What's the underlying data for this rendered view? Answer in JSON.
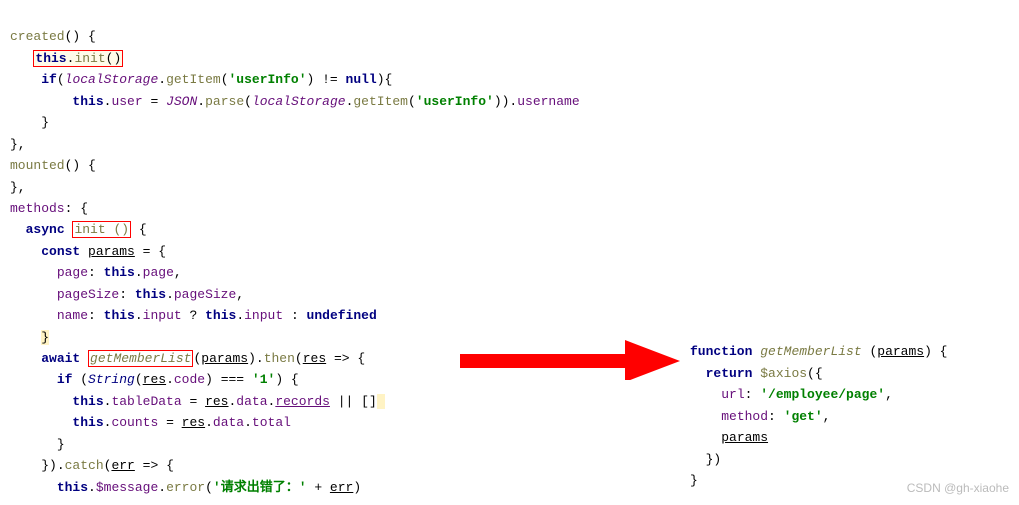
{
  "left": {
    "l1a": "created",
    "l1b": "() {",
    "l2a": "this",
    "l2b": ".",
    "l2c": "init",
    "l2d": "()",
    "l3a": "if",
    "l3b": "(",
    "l3c": "localStorage",
    "l3d": ".",
    "l3e": "getItem",
    "l3f": "(",
    "l3g": "'userInfo'",
    "l3h": ") != ",
    "l3i": "null",
    "l3j": "){",
    "l4a": "this",
    "l4b": ".",
    "l4c": "user",
    "l4d": " = ",
    "l4e": "JSON",
    "l4f": ".",
    "l4g": "parse",
    "l4h": "(",
    "l4i": "localStorage",
    "l4j": ".",
    "l4k": "getItem",
    "l4l": "(",
    "l4m": "'userInfo'",
    "l4n": ")).",
    "l4o": "username",
    "l5": "    }",
    "l6": "},",
    "l7a": "mounted",
    "l7b": "() {",
    "l8": "},",
    "l9a": "methods",
    "l9b": ": {",
    "l10a": "async",
    "l10b": " ",
    "l10c": "init ()",
    "l10d": " {",
    "l11a": "const",
    "l11b": " ",
    "l11c": "params",
    "l11d": " = {",
    "l12a": "page",
    "l12b": ": ",
    "l12c": "this",
    "l12d": ".",
    "l12e": "page",
    "l12f": ",",
    "l13a": "pageSize",
    "l13b": ": ",
    "l13c": "this",
    "l13d": ".",
    "l13e": "pageSize",
    "l13f": ",",
    "l14a": "name",
    "l14b": ": ",
    "l14c": "this",
    "l14d": ".",
    "l14e": "input",
    "l14f": " ? ",
    "l14g": "this",
    "l14h": ".",
    "l14i": "input",
    "l14j": " : ",
    "l14k": "undefined",
    "l15": "}",
    "l16a": "await",
    "l16b": " ",
    "l16c": "getMemberList",
    "l16d": "(",
    "l16e": "params",
    "l16f": ").",
    "l16g": "then",
    "l16h": "(",
    "l16i": "res",
    "l16j": " => {",
    "l17a": "if",
    "l17b": " (",
    "l17c": "String",
    "l17d": "(",
    "l17e": "res",
    "l17f": ".",
    "l17g": "code",
    "l17h": ") === ",
    "l17i": "'1'",
    "l17j": ") {",
    "l18a": "this",
    "l18b": ".",
    "l18c": "tableData",
    "l18d": " = ",
    "l18e": "res",
    "l18f": ".",
    "l18g": "data",
    "l18h": ".",
    "l18i": "records",
    "l18j": " || []",
    "l19a": "this",
    "l19b": ".",
    "l19c": "counts",
    "l19d": " = ",
    "l19e": "res",
    "l19f": ".",
    "l19g": "data",
    "l19h": ".",
    "l19i": "total",
    "l20": "}",
    "l21a": "}).",
    "l21b": "catch",
    "l21c": "(",
    "l21d": "err",
    "l21e": " => {",
    "l22a": "this",
    "l22b": ".",
    "l22c": "$message",
    "l22d": ".",
    "l22e": "error",
    "l22f": "(",
    "l22g": "'请求出错了：'",
    "l22h": " + ",
    "l22i": "err",
    "l22j": ")"
  },
  "right": {
    "r1a": "function",
    "r1b": " ",
    "r1c": "getMemberList",
    "r1d": " (",
    "r1e": "params",
    "r1f": ") {",
    "r2a": "return",
    "r2b": " ",
    "r2c": "$axios",
    "r2d": "({",
    "r3a": "url",
    "r3b": ": ",
    "r3c": "'/employee/page'",
    "r3d": ",",
    "r4a": "method",
    "r4b": ": ",
    "r4c": "'get'",
    "r4d": ",",
    "r5": "params",
    "r6": "})",
    "r7": "}"
  },
  "watermark": "CSDN @gh-xiaohe"
}
